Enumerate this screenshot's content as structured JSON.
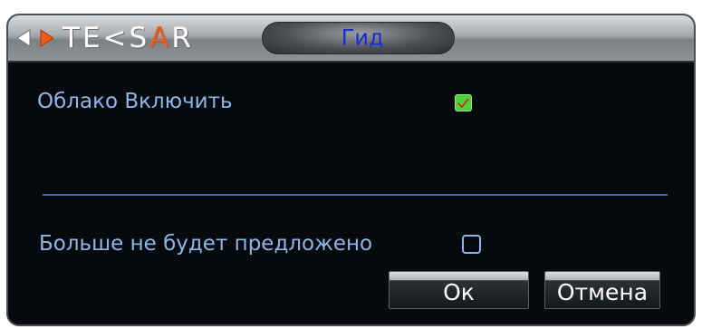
{
  "window": {
    "brand": {
      "text_part1": "T",
      "text_part2": "E",
      "text_part3": "<",
      "text_part4": "S",
      "text_part5": "A",
      "text_part6": "R"
    },
    "title": "Гид"
  },
  "cloud": {
    "label": "Облако Включить",
    "checked": true
  },
  "dont_show": {
    "label": "Больше не будет предложено",
    "checked": false
  },
  "buttons": {
    "ok_label": "Ок",
    "cancel_label": "Отмена"
  },
  "colors": {
    "label_text": "#8fb6e8",
    "title_text": "#1a2bd8",
    "checkbox_checked": "#4fcf3a",
    "checkmark": "#d81e1e",
    "divider": "#2f6fb6",
    "brand_accent": "#f05a1a"
  },
  "icons": {
    "logo_arrows": "double-arrow-icon",
    "checkmark": "checkmark-icon"
  }
}
